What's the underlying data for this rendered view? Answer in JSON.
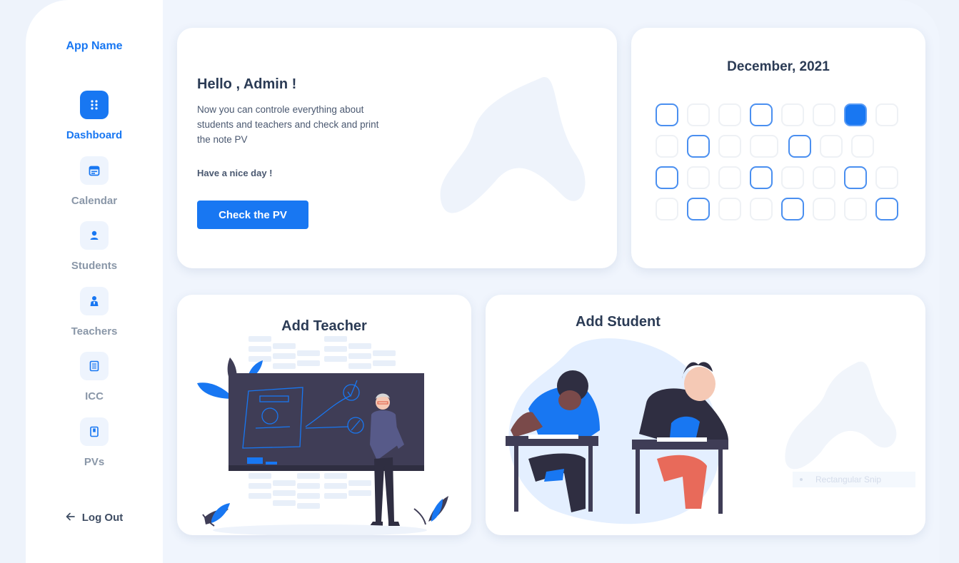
{
  "app": {
    "name": "App Name"
  },
  "sidebar": {
    "items": [
      {
        "label": "Dashboard",
        "icon": "grid-dots-icon",
        "active": true
      },
      {
        "label": "Calendar",
        "icon": "calendar-icon",
        "active": false
      },
      {
        "label": "Students",
        "icon": "student-icon",
        "active": false
      },
      {
        "label": "Teachers",
        "icon": "teacher-icon",
        "active": false
      },
      {
        "label": "ICC",
        "icon": "document-icon",
        "active": false
      },
      {
        "label": "PVs",
        "icon": "book-icon",
        "active": false
      }
    ],
    "logout_label": "Log Out"
  },
  "welcome": {
    "title": "Hello , Admin !",
    "text": "Now you can controle everything about students and teachers and check and print the note PV",
    "greeting": "Have a nice day !",
    "button_label": "Check the PV"
  },
  "calendar": {
    "title": "December, 2021",
    "rows": [
      [
        "marked",
        "empty",
        "empty",
        "marked",
        "empty",
        "empty",
        "filled",
        "empty"
      ],
      [
        "empty",
        "marked",
        "empty",
        "empty",
        "marked",
        "empty",
        "empty"
      ],
      [
        "marked",
        "empty",
        "empty",
        "marked",
        "empty",
        "empty",
        "marked",
        "empty"
      ],
      [
        "empty",
        "marked",
        "empty",
        "empty",
        "marked",
        "empty",
        "empty",
        "marked"
      ]
    ]
  },
  "add_teacher": {
    "title": "Add Teacher"
  },
  "add_student": {
    "title": "Add Student",
    "overlay_text": "Rectangular Snip"
  },
  "colors": {
    "accent": "#1877f2",
    "text_dark": "#2b3b55",
    "muted": "#8a97a8",
    "background": "#f0f5fd"
  }
}
